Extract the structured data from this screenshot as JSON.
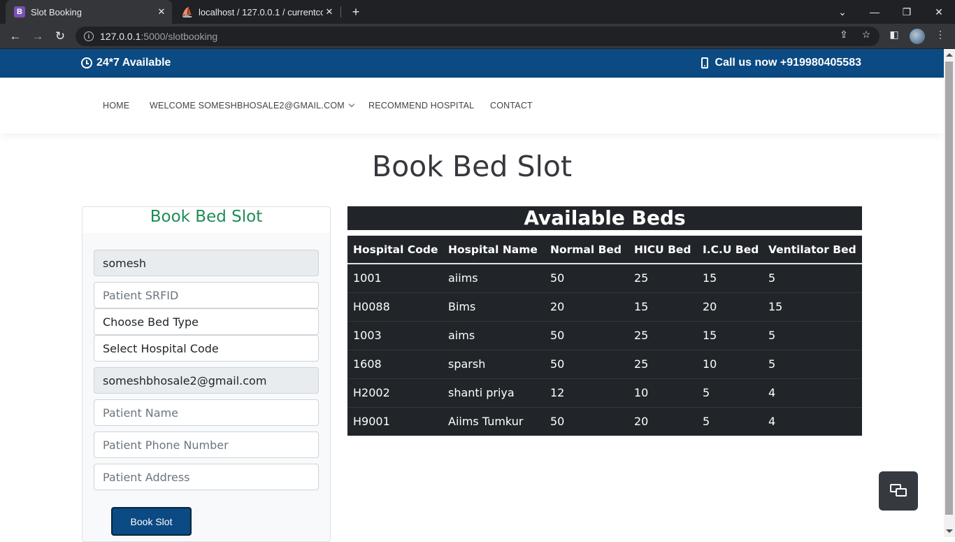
{
  "browser": {
    "tabs": [
      {
        "title": "Slot Booking",
        "favicon": "B",
        "active": true
      },
      {
        "title": "localhost / 127.0.0.1 / currentcov",
        "favicon": "phpmyadmin-icon",
        "active": false
      }
    ],
    "url_host": "127.0.0.1",
    "url_path": ":5000/slotbooking"
  },
  "topbar": {
    "availability": "24*7 Available",
    "call": "Call us now +919980405583"
  },
  "nav": {
    "items": [
      {
        "label": "HOME"
      },
      {
        "label": "WELCOME SOMESHBHOSALE2@GMAIL.COM"
      },
      {
        "label": "RECOMMEND HOSPITAL"
      },
      {
        "label": "CONTACT"
      }
    ]
  },
  "page": {
    "title": "Book Bed Slot"
  },
  "form": {
    "title": "Book Bed Slot",
    "username_value": "somesh",
    "srfid_placeholder": "Patient SRFID",
    "bed_type_selected": "Choose Bed Type",
    "hospital_code_selected": "Select Hospital Code",
    "email_value": "someshbhosale2@gmail.com",
    "patient_name_placeholder": "Patient Name",
    "patient_phone_placeholder": "Patient Phone Number",
    "patient_address_placeholder": "Patient Address",
    "submit_label": "Book Slot"
  },
  "beds": {
    "title": "Available Beds",
    "columns": [
      "Hospital Code",
      "Hospital Name",
      "Normal Bed",
      "HICU Bed",
      "I.C.U Bed",
      "Ventilator Bed"
    ],
    "rows": [
      [
        "1001",
        "aiims",
        "50",
        "25",
        "15",
        "5"
      ],
      [
        "H0088",
        "Bims",
        "20",
        "15",
        "20",
        "15"
      ],
      [
        "1003",
        "aims",
        "50",
        "25",
        "15",
        "5"
      ],
      [
        "1608",
        "sparsh",
        "50",
        "25",
        "10",
        "5"
      ],
      [
        "H2002",
        "shanti priya",
        "12",
        "10",
        "5",
        "4"
      ],
      [
        "H9001",
        "Aiims Tumkur",
        "50",
        "20",
        "5",
        "4"
      ]
    ]
  },
  "colors": {
    "brand_blue": "#0b4a82",
    "card_title_green": "#1e8c56",
    "table_dark": "#212529"
  }
}
